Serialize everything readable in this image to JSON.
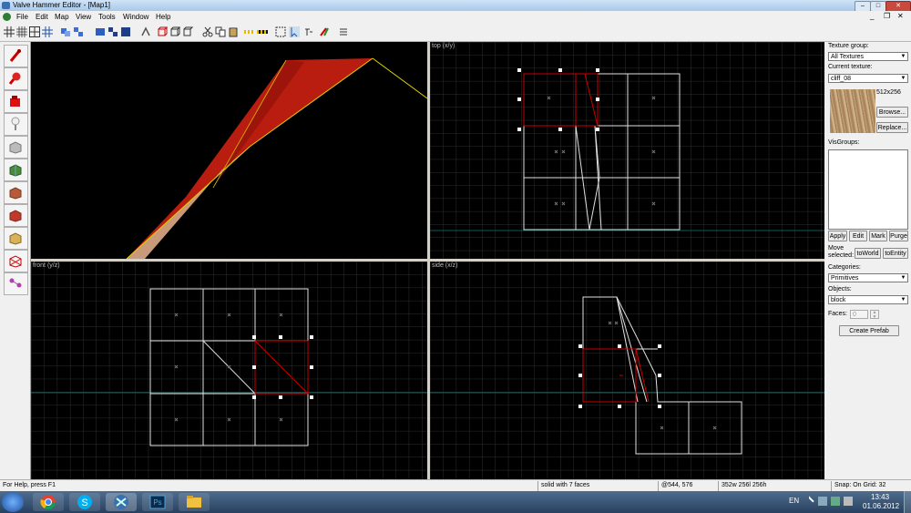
{
  "app": {
    "title": "Valve Hammer Editor - [Map1]"
  },
  "menu": [
    "File",
    "Edit",
    "Map",
    "View",
    "Tools",
    "Window",
    "Help"
  ],
  "views": {
    "top_label": "top (x/y)",
    "front_label": "front (y/z)",
    "side_label": "side (x/z)"
  },
  "panel": {
    "texture_group_label": "Texture group:",
    "texture_group_value": "All Textures",
    "current_texture_label": "Current texture:",
    "current_texture_value": "cliff_08",
    "texture_size": "512x256",
    "browse": "Browse...",
    "replace": "Replace...",
    "visgroups_label": "VisGroups:",
    "apply": "Apply",
    "edit": "Edit",
    "mark": "Mark",
    "purge": "Purge",
    "move_selected_label": "Move\nselected:",
    "to_world": "toWorld",
    "to_entity": "toEntity",
    "categories_label": "Categories:",
    "categories_value": "Primitives",
    "objects_label": "Objects:",
    "objects_value": "block",
    "faces_label": "Faces:",
    "faces_value": "0",
    "create_prefab": "Create Prefab"
  },
  "status": {
    "help": "For Help, press F1",
    "selection": "solid with 7 faces",
    "cursor": "@544, 576",
    "size": "352w 256l 256h",
    "snap": "Snap: On Grid: 32"
  },
  "taskbar": {
    "lang": "EN",
    "time": "13:43",
    "date": "01.06.2012"
  },
  "colors": {
    "selection": "#cc0000",
    "brush": "#e0e0e0",
    "grid": "#2e2e2e",
    "axis": "#0f5a5a"
  }
}
